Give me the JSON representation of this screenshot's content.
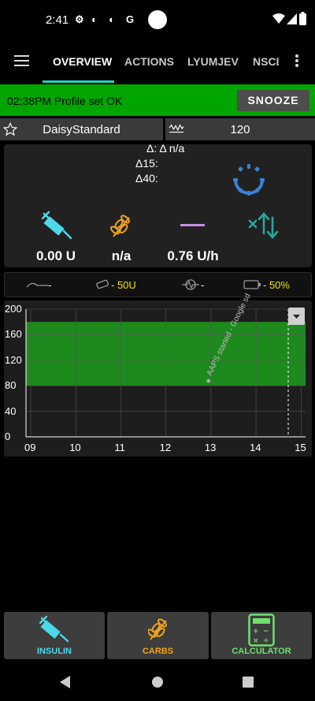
{
  "status_bar": {
    "time": "2:41",
    "icons": [
      "gear-icon",
      "sync-icon",
      "sync-icon",
      "google-icon",
      "wifi-icon",
      "signal-icon",
      "battery-icon"
    ]
  },
  "app_bar": {
    "tabs": [
      {
        "label": "OVERVIEW",
        "active": true
      },
      {
        "label": "ACTIONS",
        "active": false
      },
      {
        "label": "LYUMJEV",
        "active": false
      },
      {
        "label": "NSCL",
        "active": false
      }
    ]
  },
  "alarm": {
    "message": "02:38PM Profile set OK",
    "snooze_label": "SNOOZE",
    "color": "#00a500"
  },
  "profile": {
    "name": "DaisyStandard",
    "target": "120"
  },
  "deltas": {
    "delta": "Δ: Δ n/a",
    "delta15": "Δ15:",
    "delta40": "Δ40:"
  },
  "info": {
    "iob": "0.00 U",
    "cob": "n/a",
    "basal": "0.76 U/h"
  },
  "status_line": {
    "cannula": "-",
    "reservoir": "- 50U",
    "sensor": "-",
    "battery": "- 50%"
  },
  "chart_data": {
    "type": "line",
    "ylim": [
      0,
      200
    ],
    "yticks": [
      "0",
      "40",
      "80",
      "120",
      "160",
      "200"
    ],
    "xticks": [
      "09",
      "10",
      "11",
      "12",
      "13",
      "14",
      "15"
    ],
    "target_range": [
      80,
      180
    ],
    "series": [],
    "annotations": [
      {
        "x": 13.0,
        "y": 100,
        "text": "AAPS started - Google sd"
      }
    ]
  },
  "bottom_buttons": [
    {
      "label": "INSULIN",
      "color": "#4dd9e8"
    },
    {
      "label": "CARBS",
      "color": "#f0a31c"
    },
    {
      "label": "CALCULATOR",
      "color": "#6ee06e"
    }
  ],
  "colors": {
    "accent": "#22d3c5",
    "range": "#1e8a1e",
    "loop": "#3b82d6"
  }
}
